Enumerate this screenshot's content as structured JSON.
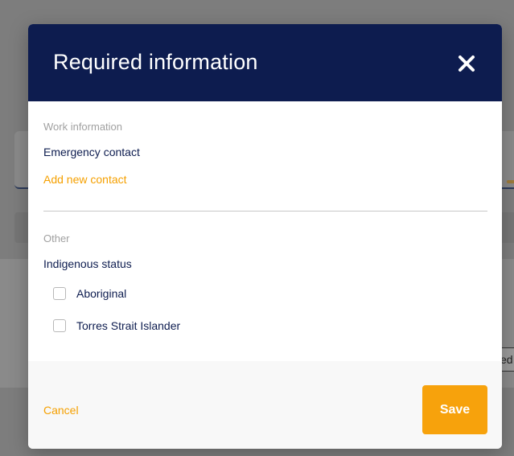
{
  "background": {
    "partial_tab_text": "ed"
  },
  "modal": {
    "title": "Required information",
    "close_icon": "close-icon",
    "sections": {
      "work": {
        "heading": "Work information",
        "emergency_contact_label": "Emergency contact",
        "add_contact_link": "Add new contact"
      },
      "other": {
        "heading": "Other",
        "indigenous_status_label": "Indigenous status",
        "options": [
          {
            "label": "Aboriginal",
            "checked": false
          },
          {
            "label": "Torres Strait Islander",
            "checked": false
          }
        ]
      }
    },
    "footer": {
      "cancel_label": "Cancel",
      "save_label": "Save"
    }
  },
  "colors": {
    "header_bg": "#0d1c4f",
    "accent": "#f5a000",
    "save_button": "#f7a20c",
    "text_primary": "#0d1c4f",
    "text_muted": "#a0a0a0"
  }
}
